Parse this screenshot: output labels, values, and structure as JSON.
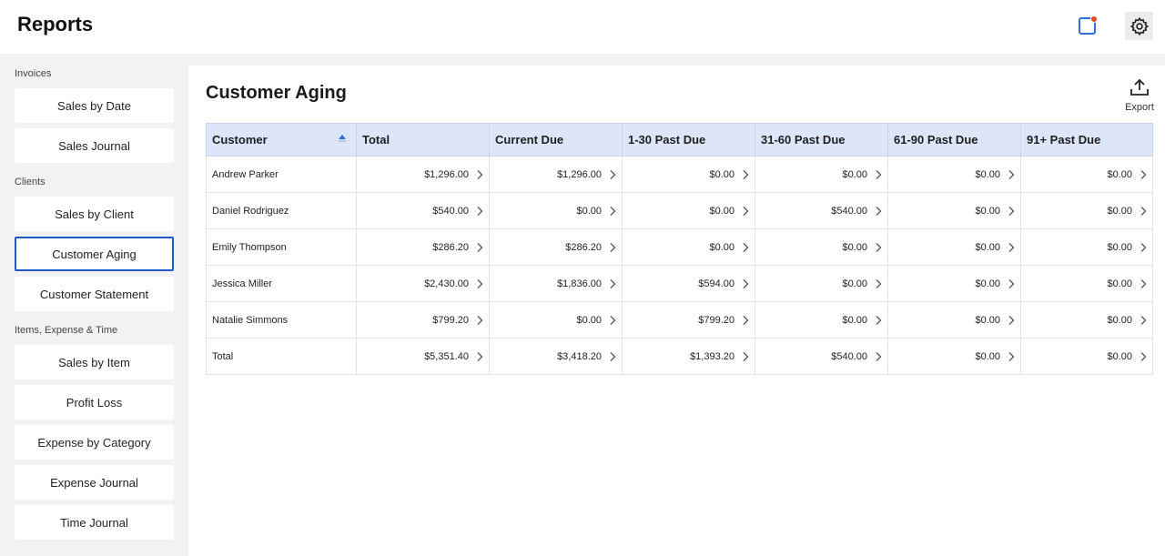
{
  "app": {
    "title": "Reports"
  },
  "icons": {
    "notification": "notification-icon",
    "settings": "gear-icon",
    "export": "upload-icon",
    "row_link": "chevron-right-icon",
    "sort": "sort-ascending-icon"
  },
  "colors": {
    "accent": "#1f5bc6",
    "notification_dot": "#e8461b",
    "header_bg": "#dde6f8"
  },
  "sidebar": {
    "sections": [
      {
        "label": "Invoices",
        "items": [
          "Sales by Date",
          "Sales Journal"
        ]
      },
      {
        "label": "Clients",
        "items": [
          "Sales by Client",
          "Customer Aging",
          "Customer Statement"
        ]
      },
      {
        "label": "Items, Expense & Time",
        "items": [
          "Sales by Item",
          "Profit Loss",
          "Expense by Category",
          "Expense Journal",
          "Time Journal"
        ]
      }
    ],
    "active": "Customer Aging"
  },
  "main": {
    "title": "Customer Aging",
    "export_label": "Export",
    "columns": [
      "Customer",
      "Total",
      "Current Due",
      "1-30 Past Due",
      "31-60 Past Due",
      "61-90 Past Due",
      "91+ Past Due"
    ],
    "sorted_column": "Customer",
    "rows": [
      {
        "name": "Andrew Parker",
        "values": [
          "$1,296.00",
          "$1,296.00",
          "$0.00",
          "$0.00",
          "$0.00",
          "$0.00"
        ]
      },
      {
        "name": "Daniel Rodriguez",
        "values": [
          "$540.00",
          "$0.00",
          "$0.00",
          "$540.00",
          "$0.00",
          "$0.00"
        ]
      },
      {
        "name": "Emily Thompson",
        "values": [
          "$286.20",
          "$286.20",
          "$0.00",
          "$0.00",
          "$0.00",
          "$0.00"
        ]
      },
      {
        "name": "Jessica Miller",
        "values": [
          "$2,430.00",
          "$1,836.00",
          "$594.00",
          "$0.00",
          "$0.00",
          "$0.00"
        ]
      },
      {
        "name": "Natalie Simmons",
        "values": [
          "$799.20",
          "$0.00",
          "$799.20",
          "$0.00",
          "$0.00",
          "$0.00"
        ]
      },
      {
        "name": "Total",
        "values": [
          "$5,351.40",
          "$3,418.20",
          "$1,393.20",
          "$540.00",
          "$0.00",
          "$0.00"
        ]
      }
    ]
  }
}
